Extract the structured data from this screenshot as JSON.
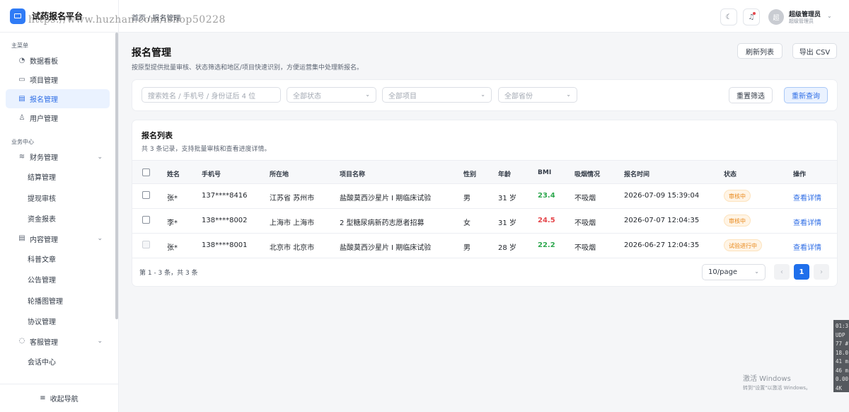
{
  "brand": {
    "title": "试药报名平台",
    "watermark": "https://www.huzhan.com/ishop50228"
  },
  "sidebar": {
    "groups": [
      {
        "label": "主菜单",
        "items": [
          {
            "label": "数据看板",
            "icon": "dashboard-icon"
          },
          {
            "label": "项目管理",
            "icon": "folder-icon"
          },
          {
            "label": "报名管理",
            "icon": "document-icon",
            "active": true
          },
          {
            "label": "用户管理",
            "icon": "user-icon"
          }
        ]
      },
      {
        "label": "业务中心",
        "items": [
          {
            "label": "财务管理",
            "icon": "database-icon",
            "children": [
              "结算管理",
              "提现审核",
              "资金报表"
            ]
          },
          {
            "label": "内容管理",
            "icon": "document-icon",
            "children": [
              "科普文章",
              "公告管理",
              "轮播图管理",
              "协议管理"
            ]
          },
          {
            "label": "客服管理",
            "icon": "chat-icon",
            "children": [
              "会话中心"
            ]
          }
        ]
      }
    ],
    "collapse_label": "收起导航"
  },
  "header": {
    "breadcrumb": [
      "首页",
      "报名管理"
    ],
    "user": {
      "avatar_text": "超",
      "name": "超级管理员",
      "role": "超级管理员"
    }
  },
  "page": {
    "title": "报名管理",
    "subtitle": "按原型提供批量审核、状态筛选和地区/项目快速识别，方便运营集中处理新报名。",
    "refresh_label": "刷新列表",
    "export_label": "导出 CSV"
  },
  "filters": {
    "search_placeholder": "搜索姓名 / 手机号 / 身份证后 4 位",
    "status": "全部状态",
    "project": "全部项目",
    "province": "全部省份",
    "reset_label": "重置筛选",
    "query_label": "重新查询"
  },
  "table": {
    "title": "报名列表",
    "subtitle": "共 3 条记录，支持批量审核和查看进度详情。",
    "columns": [
      "姓名",
      "手机号",
      "所在地",
      "项目名称",
      "性别",
      "年龄",
      "BMI",
      "吸烟情况",
      "报名时间",
      "状态",
      "操作"
    ],
    "rows": [
      {
        "name": "张*",
        "phone": "137****8416",
        "location": "江苏省 苏州市",
        "project": "盐酸莫西沙星片 I 期临床试验",
        "gender": "男",
        "age": "31 岁",
        "bmi": "23.4",
        "bmi_color": "#2fa84f",
        "smoking": "不吸烟",
        "time": "2026-07-09 15:39:04",
        "status": "审核中",
        "action": "查看详情",
        "selectable": true
      },
      {
        "name": "李*",
        "phone": "138****8002",
        "location": "上海市 上海市",
        "project": "2 型糖尿病新药志愿者招募",
        "gender": "女",
        "age": "31 岁",
        "bmi": "24.5",
        "bmi_color": "#e5484d",
        "smoking": "不吸烟",
        "time": "2026-07-07 12:04:35",
        "status": "审核中",
        "action": "查看详情",
        "selectable": true
      },
      {
        "name": "张*",
        "phone": "138****8001",
        "location": "北京市 北京市",
        "project": "盐酸莫西沙星片 I 期临床试验",
        "gender": "男",
        "age": "28 岁",
        "bmi": "22.2",
        "bmi_color": "#2fa84f",
        "smoking": "不吸烟",
        "time": "2026-06-27 12:04:35",
        "status": "试验进行中",
        "action": "查看详情",
        "selectable": false
      }
    ]
  },
  "pagination": {
    "summary": "第 1 - 3 条，共 3 条",
    "page_size": "10/page",
    "current_page": "1",
    "prev": "‹",
    "next": "›"
  },
  "windows_watermark": {
    "line1": "激活 Windows",
    "line2": "转到\"设置\"以激活 Windows。"
  },
  "overlay_lines": [
    "01:3",
    "UDP",
    "77 #",
    "18.0",
    "41 m",
    "46 m",
    "0.00",
    "4K"
  ],
  "colors": {
    "accent": "#2f6ee6",
    "active_bg": "#eaf2ff",
    "warning_bg": "#fff4e5",
    "warning_text": "#e8891c"
  }
}
